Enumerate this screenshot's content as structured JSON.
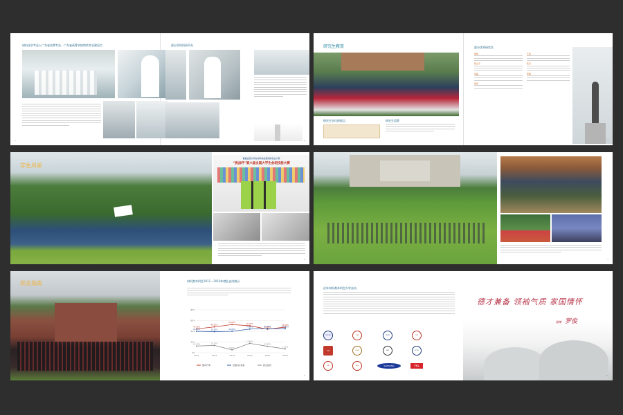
{
  "spread1": {
    "left_caption": "材料化学专业入广东省名牌专业、广东省高等学校特色专业建设点",
    "right_caption": "部分学科科研平台",
    "page_left": "1",
    "page_right": "2"
  },
  "spread2": {
    "heading": "研究生教育",
    "box1_title": "研究生学位授权点",
    "box2_title": "研究生培养",
    "right_heading": "部分优秀研究生",
    "names": [
      "黄辉",
      "韩立平",
      "刘磊",
      "张伟",
      "王晨",
      "陈涛",
      "李娜"
    ],
    "page": "3"
  },
  "spread3": {
    "heading": "学生风采",
    "banner_line1": "“挑战杯”第六届全国大学生金相技能大赛",
    "banner_top": "首届全国大学生材料热处理创新创业大赛",
    "page": "5"
  },
  "spread4": {
    "page": "7"
  },
  "spread5": {
    "heading": "就业指南",
    "chart_title": "材料类本科生2011－2016年就业去向统计",
    "page": "9"
  },
  "spread6": {
    "heading": "近年材料类本科生升学去向",
    "calligraphy": "德才兼备 领袖气质 家国情怀",
    "signature_prefix": "题赠",
    "signature": "罗俊",
    "logos": [
      "OXFORD",
      "CAS",
      "PENN",
      "MIT",
      "UH",
      "UNSW",
      "HKU",
      "UCSD",
      "THU",
      "NUS",
      "SAMSUNG",
      "TCL"
    ],
    "page": "10"
  },
  "chart_data": {
    "type": "line",
    "title": "材料类本科生2011－2016年就业去向统计",
    "x": [
      "2011",
      "2012",
      "2013",
      "2014",
      "2015",
      "2016"
    ],
    "ylim": [
      0,
      80
    ],
    "series": [
      {
        "name": "国内升学",
        "values": [
          44.5,
          48.2,
          52.6,
          50.4,
          44.0,
          47.8
        ],
        "color": "#c0392b"
      },
      {
        "name": "出国(境)深造",
        "values": [
          40.1,
          39.3,
          40.0,
          44.2,
          45.0,
          44.8
        ],
        "color": "#2e5aa8"
      },
      {
        "name": "就业签约",
        "values": [
          12.5,
          13.7,
          5.4,
          17.6,
          12.0,
          7.2
        ],
        "color": "#888888"
      }
    ]
  }
}
